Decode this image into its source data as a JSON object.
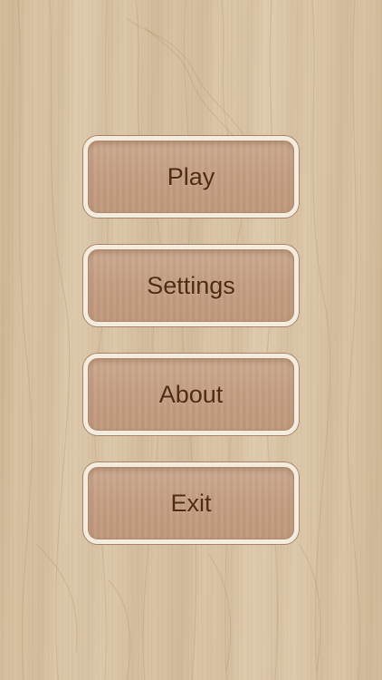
{
  "menu": {
    "play_label": "Play",
    "settings_label": "Settings",
    "about_label": "About",
    "exit_label": "Exit"
  },
  "colors": {
    "background_wood": "#d8c3a4",
    "button_fill": "#c49f84",
    "button_border": "#f5ece0",
    "button_text": "#4d2b15"
  }
}
